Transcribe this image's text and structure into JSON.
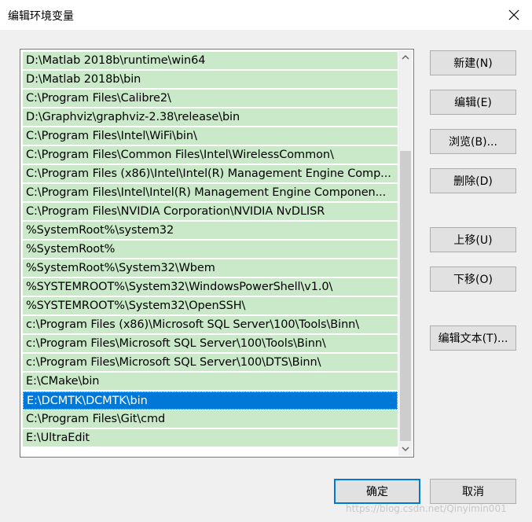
{
  "window": {
    "title": "编辑环境变量"
  },
  "path_list": {
    "items": [
      "D:\\Matlab 2018b\\runtime\\win64",
      "D:\\Matlab 2018b\\bin",
      "C:\\Program Files\\Calibre2\\",
      "D:\\Graphviz\\graphviz-2.38\\release\\bin",
      "C:\\Program Files\\Intel\\WiFi\\bin\\",
      "C:\\Program Files\\Common Files\\Intel\\WirelessCommon\\",
      "C:\\Program Files (x86)\\Intel\\Intel(R) Management Engine Comp...",
      "C:\\Program Files\\Intel\\Intel(R) Management Engine Componen...",
      "C:\\Program Files\\NVIDIA Corporation\\NVIDIA NvDLISR",
      "%SystemRoot%\\system32",
      "%SystemRoot%",
      "%SystemRoot%\\System32\\Wbem",
      "%SYSTEMROOT%\\System32\\WindowsPowerShell\\v1.0\\",
      "%SYSTEMROOT%\\System32\\OpenSSH\\",
      "c:\\Program Files (x86)\\Microsoft SQL Server\\100\\Tools\\Binn\\",
      "c:\\Program Files\\Microsoft SQL Server\\100\\Tools\\Binn\\",
      "c:\\Program Files\\Microsoft SQL Server\\100\\DTS\\Binn\\",
      "E:\\CMake\\bin",
      "E:\\DCMTK\\DCMTK\\bin",
      "C:\\Program Files\\Git\\cmd",
      "E:\\UltraEdit"
    ],
    "selected_index": 18
  },
  "buttons": {
    "new": "新建(N)",
    "edit": "编辑(E)",
    "browse": "浏览(B)...",
    "delete": "删除(D)",
    "move_up": "上移(U)",
    "move_down": "下移(O)",
    "edit_text": "编辑文本(T)...",
    "ok": "确定",
    "cancel": "取消"
  },
  "watermark": "https://blog.csdn.net/Qinyimin001",
  "colors": {
    "row_background": "#c9e9c9",
    "selected_background": "#0078d7",
    "default_button_border": "#0078d7"
  }
}
